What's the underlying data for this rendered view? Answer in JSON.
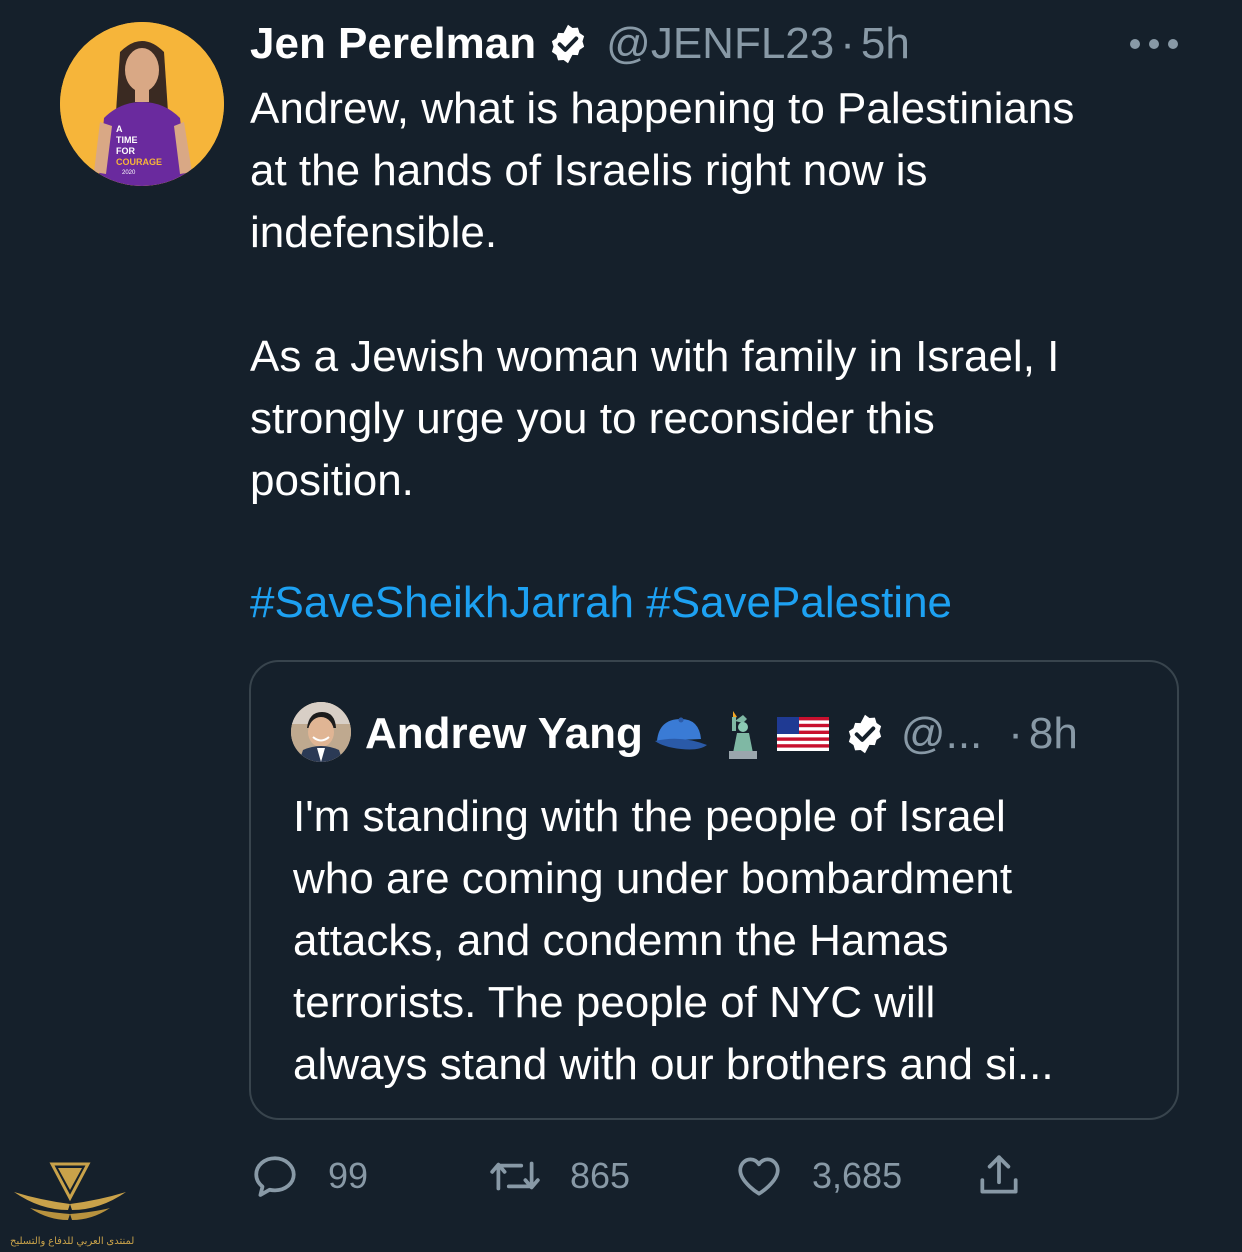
{
  "tweet": {
    "author": {
      "display_name": "Jen Perelman",
      "handle": "@JENFL23",
      "time": "5h",
      "avatar_icon": "profile-photo-avatar",
      "shirt_text": [
        "A",
        "TIME",
        "FOR",
        "COURAGE",
        "2020"
      ]
    },
    "separator": "·",
    "text_lines": [
      "Andrew, what is happening to Palestinians",
      "at the hands of Israelis right now is",
      "indefensible.",
      "As a Jewish woman with family in Israel, I",
      "strongly urge you to reconsider this",
      "position."
    ],
    "hashtags": [
      "#SaveSheikhJarrah",
      "#SavePalestine"
    ],
    "more_icon": "more-dots-icon"
  },
  "quoted_tweet": {
    "display_name": "Andrew Yang",
    "emojis": [
      "blue-cap-emoji",
      "statue-of-liberty-emoji",
      "us-flag-emoji"
    ],
    "handle": "@...",
    "time": "8h",
    "text_lines": [
      "I'm standing with the people of Israel",
      "who are coming under bombardment",
      "attacks, and condemn the Hamas",
      "terrorists. The people of NYC will",
      "always stand with our brothers and si..."
    ]
  },
  "actions": {
    "reply_count": "99",
    "retweet_count": "865",
    "like_count": "3,685"
  },
  "watermark": {
    "text": "المنتدى العربي للدفاع والتسليح"
  },
  "colors": {
    "background": "#15202b",
    "text": "#ffffff",
    "secondary": "#8899a6",
    "link": "#1da1f2",
    "border": "#38444d"
  }
}
